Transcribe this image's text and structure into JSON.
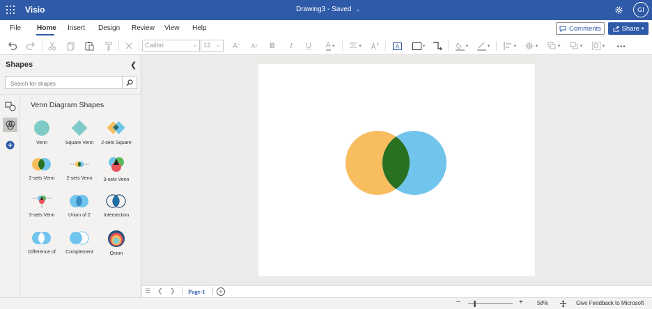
{
  "app": {
    "name": "Visio",
    "doc_status": "Drawing3 - Saved",
    "avatar_initials": "GI",
    "brand_color": "#2f5aa8"
  },
  "menu": {
    "items": [
      "File",
      "Home",
      "Insert",
      "Design",
      "Review",
      "View",
      "Help"
    ],
    "active": "Home",
    "comments_label": "Comments",
    "share_label": "Share"
  },
  "toolbar": {
    "font_name": "Calibri",
    "font_size": "12",
    "bold_glyph": "B",
    "italic_glyph": "I",
    "underline_glyph": "U",
    "grow_glyph": "A",
    "shrink_glyph": "A",
    "font_color_glyph": "A",
    "more_glyph": "···"
  },
  "shapes_panel": {
    "title": "Shapes",
    "search_placeholder": "Search for shapes",
    "stencil_title": "Venn Diagram Shapes",
    "shapes": [
      {
        "label": "Venn",
        "icon": "venn-circle-icon"
      },
      {
        "label": "Square Venn",
        "icon": "square-venn-icon"
      },
      {
        "label": "2-sets Square",
        "icon": "two-sets-square-icon"
      },
      {
        "label": "2-sets Venn",
        "icon": "two-sets-venn-icon"
      },
      {
        "label": "2-sets Venn",
        "icon": "two-sets-venn-small-icon"
      },
      {
        "label": "3-sets Venn",
        "icon": "three-sets-venn-icon"
      },
      {
        "label": "3-sets Venn",
        "icon": "three-sets-venn-small-icon"
      },
      {
        "label": "Union of 2",
        "icon": "union-of-two-icon"
      },
      {
        "label": "Intersection",
        "icon": "intersection-icon"
      },
      {
        "label": "Difference of",
        "icon": "difference-icon"
      },
      {
        "label": "Complement",
        "icon": "complement-icon"
      },
      {
        "label": "Onion",
        "icon": "onion-icon"
      }
    ]
  },
  "canvas": {
    "diagram": "two-sets-venn",
    "colors": {
      "left": "#f7bd5f",
      "right": "#71c5ec",
      "overlap": "#2a7021"
    }
  },
  "pagebar": {
    "page_tab": "Page-1",
    "add_glyph": "+"
  },
  "statusbar": {
    "zoom_minus": "−",
    "zoom_plus": "+",
    "zoom_level": "58%",
    "feedback": "Give Feedback to Microsoft"
  }
}
